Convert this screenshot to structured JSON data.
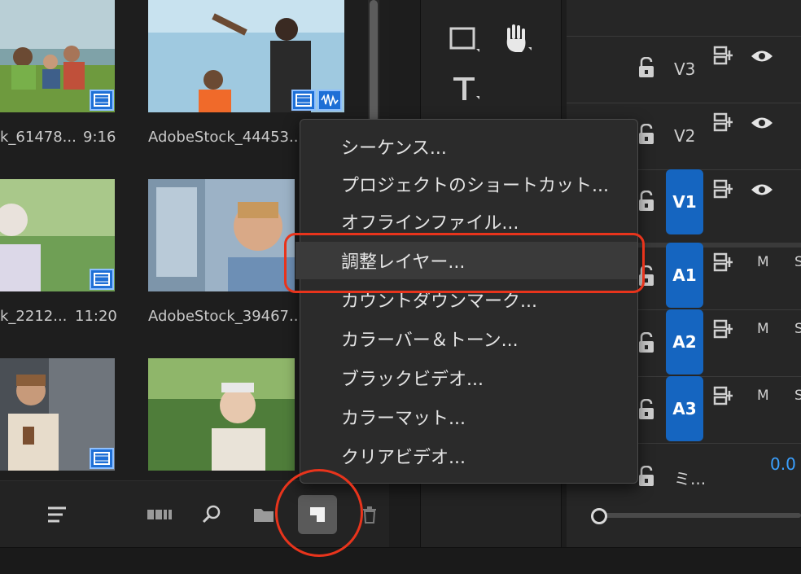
{
  "project_panel": {
    "clips": [
      {
        "name": "k_61478...",
        "duration": "9:16"
      },
      {
        "name": "AdobeStock_44453...",
        "duration": ""
      },
      {
        "name": "k_2212...",
        "duration": "11:20"
      },
      {
        "name": "AdobeStock_39467...",
        "duration": ""
      }
    ],
    "toolbar_icons": [
      "list-view-icon",
      "freeform-view-icon",
      "search-icon",
      "new-bin-icon",
      "new-item-icon",
      "trash-icon"
    ]
  },
  "tools_panel": {
    "tools": [
      "rectangle-tool-icon",
      "hand-tool-icon",
      "type-tool-icon"
    ]
  },
  "timeline": {
    "tracks": [
      {
        "label": "V3",
        "type": "video",
        "targeted": false
      },
      {
        "label": "V2",
        "type": "video",
        "targeted": false
      },
      {
        "label": "V1",
        "type": "video",
        "targeted": true
      },
      {
        "label": "A1",
        "type": "audio",
        "targeted": true,
        "mute": "M",
        "solo": "S"
      },
      {
        "label": "A2",
        "type": "audio",
        "targeted": true,
        "mute": "M",
        "solo": "S"
      },
      {
        "label": "A3",
        "type": "audio",
        "targeted": true,
        "mute": "M",
        "solo": "S"
      }
    ],
    "mix_label": "ミ...",
    "mix_value": "0.0"
  },
  "menu": {
    "items": [
      "シーケンス...",
      "プロジェクトのショートカット...",
      "オフラインファイル...",
      "調整レイヤー...",
      "カウントダウンマーク...",
      "カラーバー＆トーン...",
      "ブラックビデオ...",
      "カラーマット...",
      "クリアビデオ..."
    ],
    "highlighted_index": 3
  },
  "colors": {
    "accent_blue": "#1565c0",
    "annotation_red": "#e8341c",
    "value_blue": "#3aa0ff"
  }
}
